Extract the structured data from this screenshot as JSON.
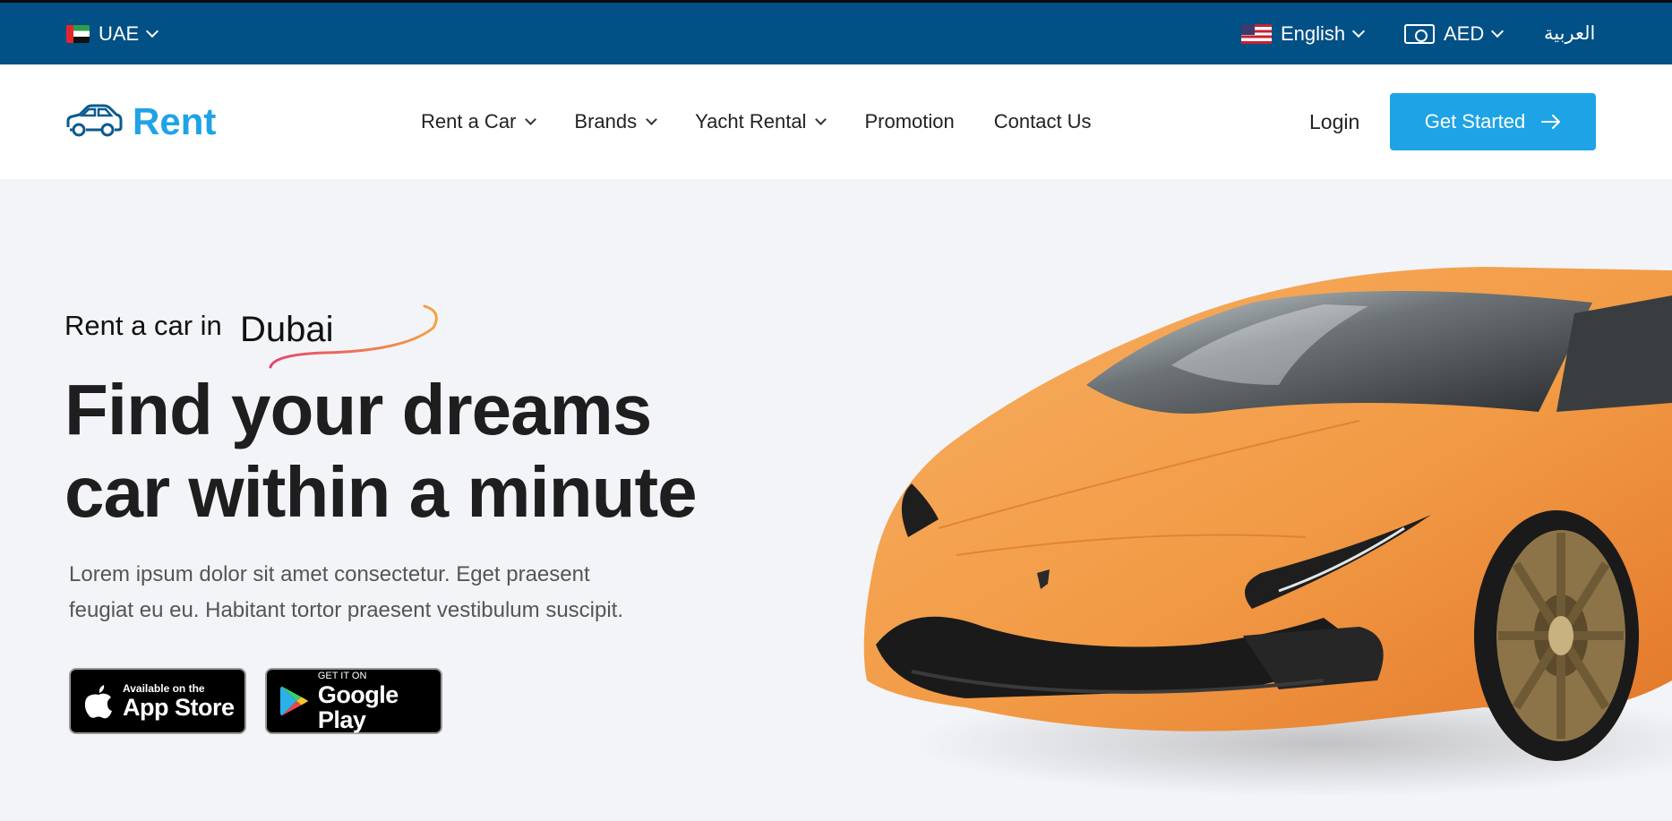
{
  "topbar": {
    "region": "UAE",
    "language": "English",
    "currency": "AED",
    "arabic_link": "العربية"
  },
  "header": {
    "logo_text": "Rent",
    "nav": [
      {
        "label": "Rent a Car",
        "dropdown": true
      },
      {
        "label": "Brands",
        "dropdown": true
      },
      {
        "label": "Yacht Rental",
        "dropdown": true
      },
      {
        "label": "Promotion",
        "dropdown": false
      },
      {
        "label": "Contact Us",
        "dropdown": false
      }
    ],
    "login_label": "Login",
    "cta_label": "Get Started"
  },
  "hero": {
    "eyebrow_prefix": "Rent a car in",
    "eyebrow_city": "Dubai",
    "headline_line1": "Find your dreams",
    "headline_line2": "car within a minute",
    "description_line1": "Lorem ipsum dolor sit amet consectetur. Eget praesent",
    "description_line2": "feugiat eu eu. Habitant tortor praesent vestibulum suscipit.",
    "app_store": {
      "small": "Available on the",
      "big": "App Store"
    },
    "google_play": {
      "small": "GET IT ON",
      "big": "Google Play"
    }
  },
  "colors": {
    "topbar": "#015086",
    "accent": "#1ea3e6",
    "car_body": "#f29a45"
  }
}
